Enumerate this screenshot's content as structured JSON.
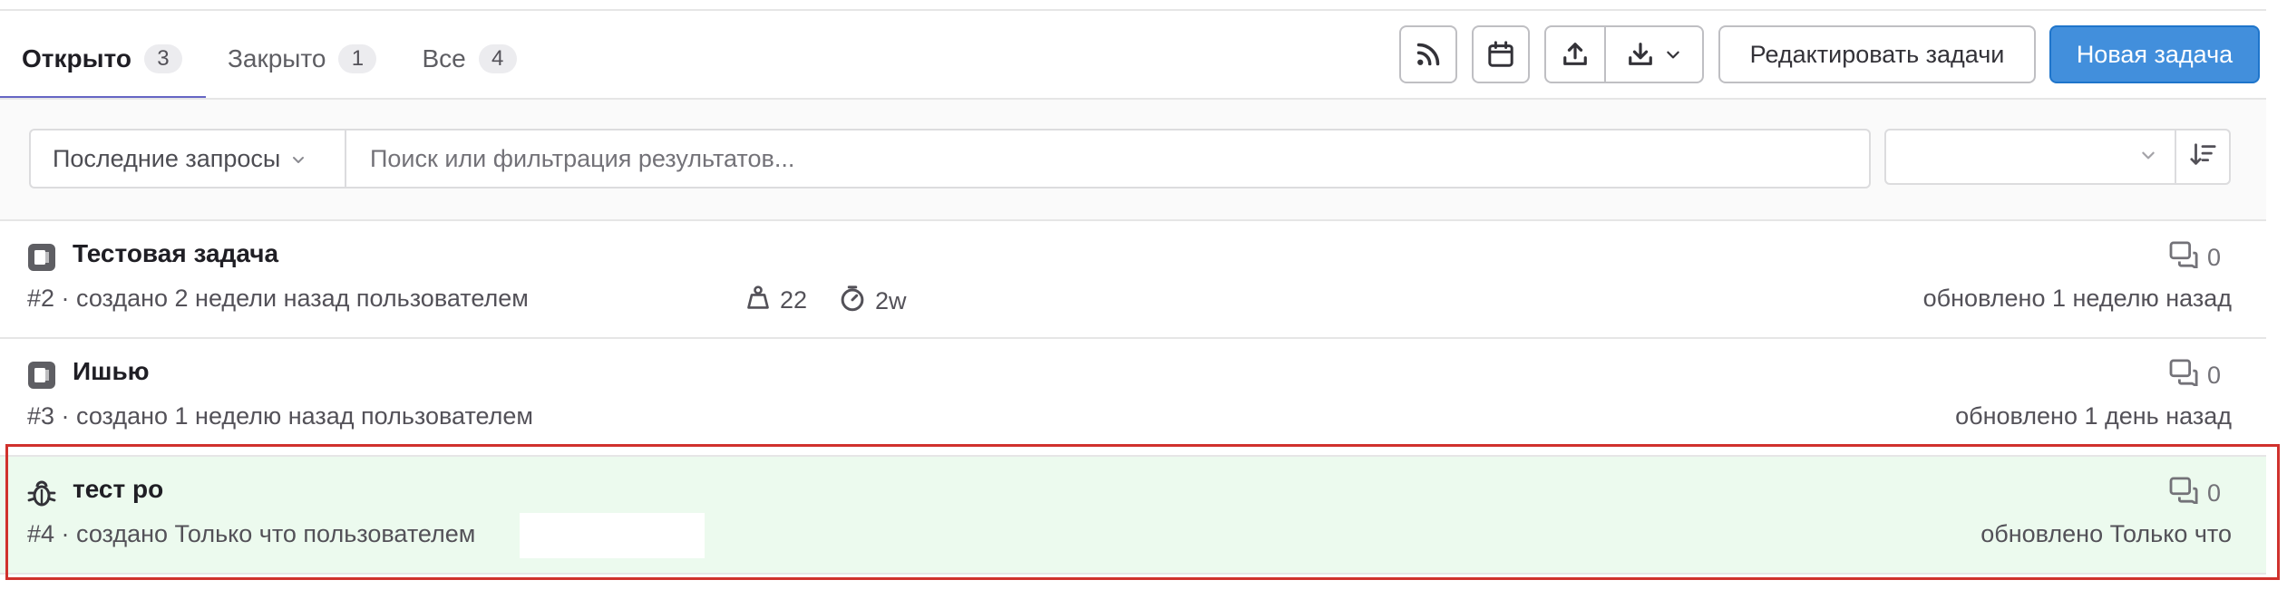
{
  "tabs": [
    {
      "label": "Открыто",
      "count": "3"
    },
    {
      "label": "Закрыто",
      "count": "1"
    },
    {
      "label": "Все",
      "count": "4"
    }
  ],
  "toolbar": {
    "rss_icon": "rss-icon",
    "calendar_icon": "calendar-icon",
    "export_icon": "upload-icon",
    "import_icon": "download-icon",
    "edit_label": "Редактировать задачи",
    "new_label": "Новая задача",
    "primary_color": "#428fdc"
  },
  "filter": {
    "recent_label": "Последние запросы",
    "search_placeholder": "Поиск или фильтрация результатов...",
    "sort_value": ""
  },
  "issues": [
    {
      "type_icon": "issue-type-icon",
      "title": "Тестовая задача",
      "meta": "#2 · создано 2 недели назад пользователем",
      "weight": "22",
      "time_estimate": "2w",
      "comments": "0",
      "updated": "обновлено 1 неделю назад"
    },
    {
      "type_icon": "issue-type-icon",
      "title": "Ишью",
      "meta": "#3 · создано 1 неделю назад пользователем",
      "comments": "0",
      "updated": "обновлено 1 день назад"
    },
    {
      "type_icon": "bug-icon",
      "title": "тест ро",
      "meta": "#4 · создано Только что пользователем",
      "comments": "0",
      "updated": "обновлено Только что",
      "highlight_color": "#ecfaee",
      "outline_color": "#d0312d"
    }
  ]
}
